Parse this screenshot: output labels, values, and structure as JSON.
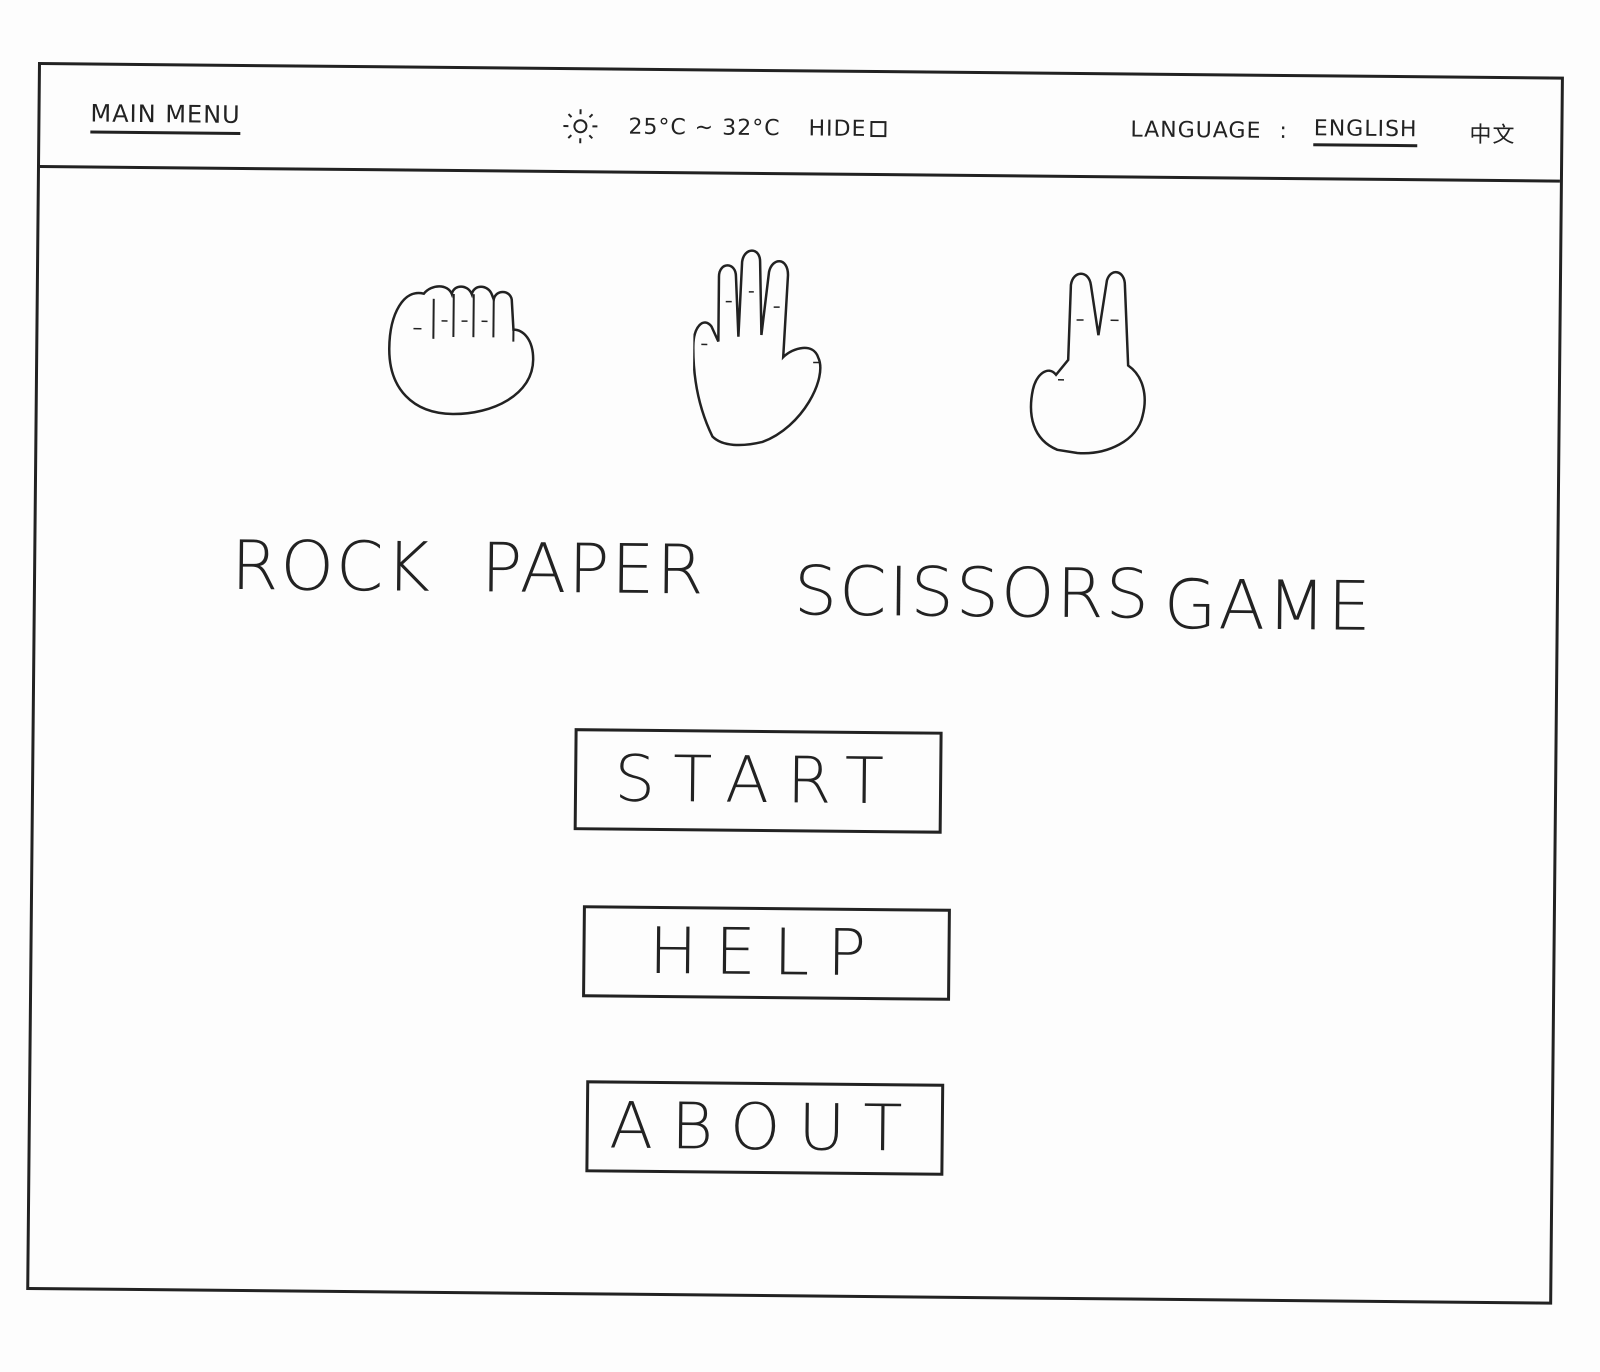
{
  "header": {
    "main_menu_label": "MAIN MENU",
    "weather": {
      "icon": "sun-icon",
      "temperature_range": "25°C ~ 32°C",
      "hide_label": "HIDE"
    },
    "language": {
      "label": "LANGUAGE",
      "separator": ":",
      "options": [
        "ENGLISH",
        "中文"
      ],
      "selected": "ENGLISH"
    }
  },
  "hero": {
    "icons": [
      "rock-hand-icon",
      "paper-hand-icon",
      "scissors-hand-icon"
    ],
    "title_words": [
      "ROCK",
      "PAPER",
      "SCISSORS",
      "GAME"
    ]
  },
  "menu": {
    "start_label": "START",
    "help_label": "HELP",
    "about_label": "ABOUT"
  }
}
